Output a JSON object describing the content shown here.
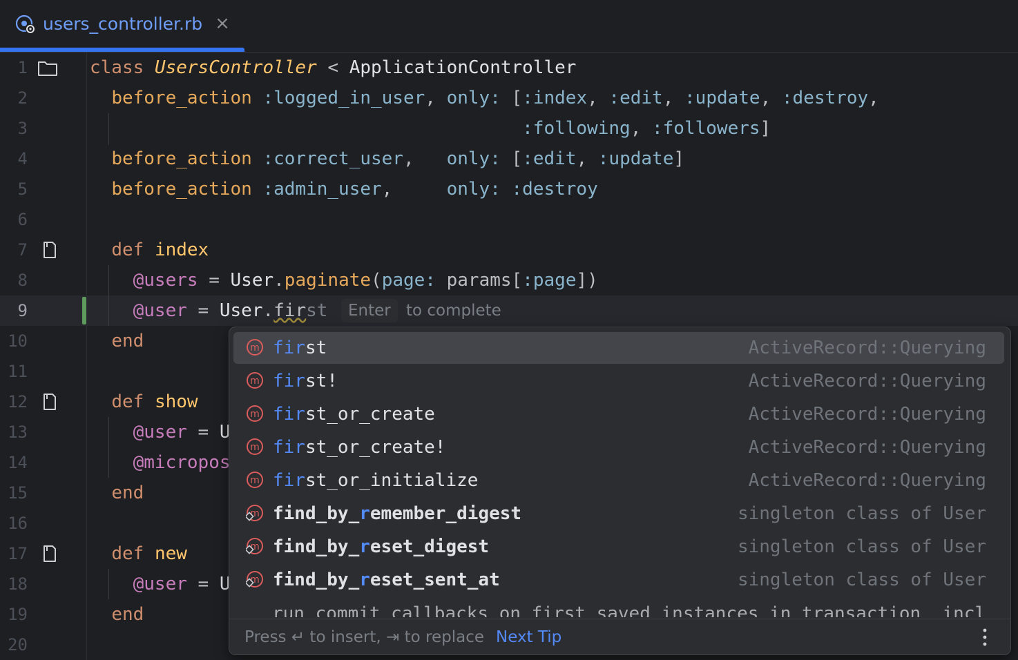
{
  "tab": {
    "filename": "users_controller.rb",
    "close": "×"
  },
  "inline_hint": {
    "key": "Enter",
    "text": "to complete"
  },
  "lines": [
    {
      "n": "1"
    },
    {
      "n": "2"
    },
    {
      "n": "3"
    },
    {
      "n": "4"
    },
    {
      "n": "5"
    },
    {
      "n": "6"
    },
    {
      "n": "7"
    },
    {
      "n": "8"
    },
    {
      "n": "9"
    },
    {
      "n": "10"
    },
    {
      "n": "11"
    },
    {
      "n": "12"
    },
    {
      "n": "13"
    },
    {
      "n": "14"
    },
    {
      "n": "15"
    },
    {
      "n": "16"
    },
    {
      "n": "17"
    },
    {
      "n": "18"
    },
    {
      "n": "19"
    },
    {
      "n": "20"
    }
  ],
  "completion": {
    "items": [
      {
        "match": "fir",
        "rest": "st",
        "type": "ActiveRecord::Querying"
      },
      {
        "match": "fir",
        "rest": "st!",
        "type": "ActiveRecord::Querying"
      },
      {
        "match": "fir",
        "rest": "st_or_create",
        "type": "ActiveRecord::Querying"
      },
      {
        "match": "fir",
        "rest": "st_or_create!",
        "type": "ActiveRecord::Querying"
      },
      {
        "match": "fir",
        "rest": "st_or_initialize",
        "type": "ActiveRecord::Querying"
      },
      {
        "pre": "find_by_",
        "match": "r",
        "post": "emember_digest",
        "type": "singleton class of User"
      },
      {
        "pre": "find_by_",
        "match": "r",
        "post": "eset_digest",
        "type": "singleton class of User"
      },
      {
        "pre": "find_by_",
        "match": "r",
        "post": "eset_sent_at",
        "type": "singleton class of User"
      }
    ],
    "partial_line": "run_commit_callbacks_on_first_saved_instances_in_transaction  incl",
    "footer_text": "Press ↵ to insert, ⇥ to replace",
    "footer_link": "Next Tip",
    "more": "⋮"
  },
  "colors": {
    "accent": "#3574f0",
    "keyword": "#cf8e6d",
    "symbol": "#89b4cb",
    "ivar": "#c77dbb",
    "method_match": "#548af7"
  }
}
